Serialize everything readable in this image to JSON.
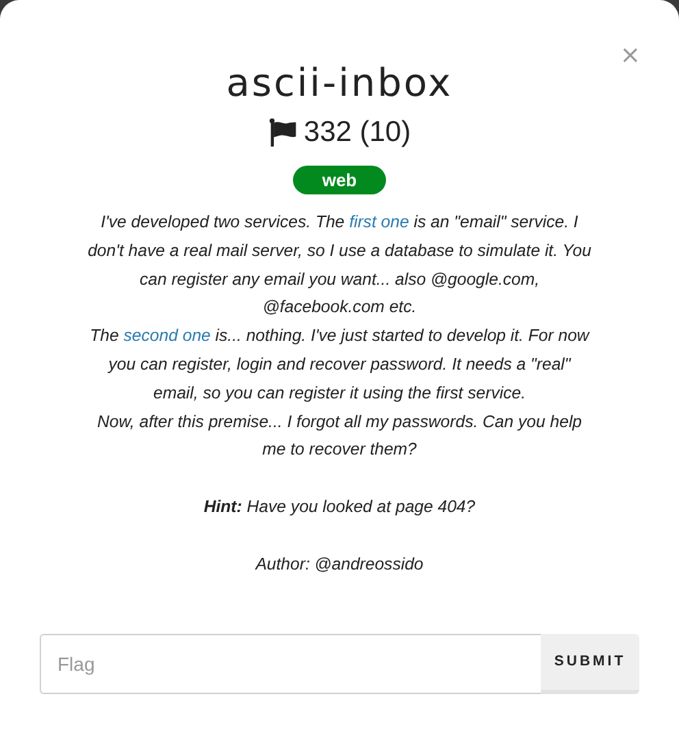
{
  "close_button": "×",
  "title": "ascii-inbox",
  "score": "332 (10)",
  "category": "web",
  "description": [
    [
      {
        "kind": "text",
        "text": "I've developed two services. The "
      },
      {
        "kind": "link",
        "text": "first one"
      },
      {
        "kind": "text",
        "text": " is an \"email\" service. I don't have a real mail server, so I use a database to simulate it. You can register any email you want... also @google.com, @facebook.com etc."
      }
    ],
    [
      {
        "kind": "text",
        "text": "The "
      },
      {
        "kind": "link",
        "text": "second one"
      },
      {
        "kind": "text",
        "text": " is... nothing. I've just started to develop it. For now you can register, login and recover password. It needs a \"real\" email, so you can register it using the first service."
      }
    ],
    [
      {
        "kind": "text",
        "text": "Now, after this premise... I forgot all my passwords. Can you help me to recover them?"
      }
    ]
  ],
  "hint": "**Hint:** Have you looked at page 404?",
  "author": "Author: @andreossido",
  "flag_field": {
    "placeholder": "Flag"
  },
  "submit_button": "SUBMIT"
}
